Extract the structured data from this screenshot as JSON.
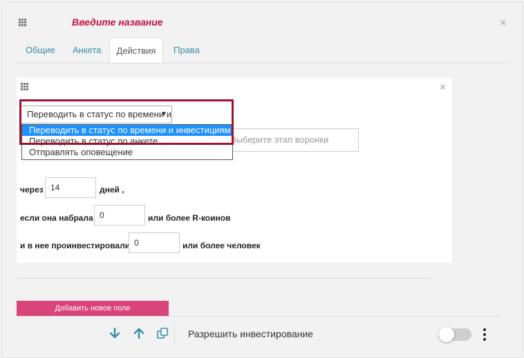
{
  "dialog": {
    "title": "Введите название",
    "close_symbol": "×",
    "drag_icon": "grid-drag-icon"
  },
  "tabs": [
    {
      "label": "Общие",
      "active": false
    },
    {
      "label": "Анкета",
      "active": false
    },
    {
      "label": "Действия",
      "active": true
    },
    {
      "label": "Права",
      "active": false
    }
  ],
  "action_card": {
    "close_symbol": "×",
    "select": {
      "value": "Переводить в статус по времени и инвестициям",
      "arrow": "▼"
    },
    "dropdown_options": [
      {
        "label": "Переводить в статус по времени и инвестициям",
        "selected": true
      },
      {
        "label": "Переводить в статус по анкете",
        "selected": false
      },
      {
        "label": "Отправлять оповещение",
        "selected": false
      }
    ],
    "stage_placeholder": "Выберите этап воронки",
    "rows": {
      "after_prefix": "через",
      "after_value": "14",
      "after_suffix": "дней ,",
      "coins_prefix": "если она набрала",
      "coins_value": "0",
      "coins_suffix": "или более R-коинов",
      "investors_prefix": "и в нее проинвестировали",
      "investors_value": "0",
      "investors_suffix": "или более человек"
    }
  },
  "add_field_button": "Добавить новое поле",
  "footer": {
    "icons": [
      "arrow-down-icon",
      "arrow-up-icon",
      "copy-icon"
    ],
    "allow_investing_label": "Разрешить инвестирование",
    "toggle_on": false
  },
  "colors": {
    "accent_title": "#c0143c",
    "tab_link": "#3a8fa8",
    "add_button": "#d9447a",
    "icon_teal": "#2e8fa7",
    "highlight_border": "#a0122d",
    "selected_option": "#1e90ff"
  }
}
